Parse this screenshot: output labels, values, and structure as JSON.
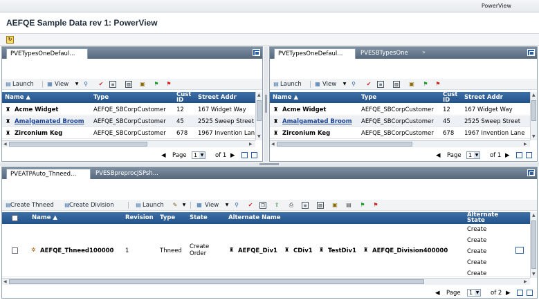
{
  "window": {
    "title": "PowerView"
  },
  "page": {
    "title": "AEFQE Sample Data rev 1: PowerView"
  },
  "toolbar": {
    "icon": "refresh-icon"
  },
  "left_pane": {
    "tabs": [
      {
        "label": "PVETypesOneDefaul..."
      }
    ],
    "toolbar": {
      "launch": "Launch",
      "view": "View"
    },
    "columns": {
      "name": "Name",
      "type": "Type",
      "cust_id_1": "Cust",
      "cust_id_2": "ID",
      "street": "Street Addr"
    },
    "rows": [
      {
        "name": "Acme Widget",
        "type": "AEFQE_SBCorpCustomer",
        "id": "12",
        "street": "167 Widget Way"
      },
      {
        "name": "Amalgamated Broom",
        "type": "AEFQE_SBCorpCustomer",
        "id": "45",
        "street": "2525 Sweep Street"
      },
      {
        "name": "Zirconium Keg",
        "type": "AEFQE_SBCorpCustomer",
        "id": "678",
        "street": "1967 Invention Lane"
      }
    ],
    "pager": {
      "page_label": "Page",
      "page_value": "1",
      "of_label": "of 1"
    }
  },
  "right_pane": {
    "tabs": [
      {
        "label": "PVETypesOneDefaul..."
      },
      {
        "label": "PVESBTypesOne"
      }
    ],
    "overflow": "»",
    "toolbar": {
      "launch": "Launch",
      "view": "View"
    },
    "columns": {
      "name": "Name",
      "type": "Type",
      "cust_id_1": "Cust",
      "cust_id_2": "ID",
      "street": "Street Addr"
    },
    "rows": [
      {
        "name": "Acme Widget",
        "type": "AEFQE_SBCorpCustomer",
        "id": "12",
        "street": "167 Widget Way"
      },
      {
        "name": "Amalgamated Broom",
        "type": "AEFQE_SBCorpCustomer",
        "id": "45",
        "street": "2525 Sweep Street"
      },
      {
        "name": "Zirconium Keg",
        "type": "AEFQE_SBCorpCustomer",
        "id": "678",
        "street": "1967 Invention Lane"
      }
    ],
    "pager": {
      "page_label": "Page",
      "page_value": "1",
      "of_label": "of 1"
    }
  },
  "bottom_pane": {
    "tabs": [
      {
        "label": "PVEATPAuto_Thneed..."
      },
      {
        "label": "PVESBpreprocJSPsh..."
      }
    ],
    "toolbar": {
      "create_thneed": "Create Thneed",
      "create_division": "Create Division",
      "launch": "Launch",
      "view": "View"
    },
    "columns": {
      "name": "Name",
      "revision": "Revision",
      "type": "Type",
      "state": "State",
      "alt_name": "Alternate Name",
      "alt_state_1": "Alternate",
      "alt_state_2": "State"
    },
    "row": {
      "name": "AEFQE_Thneed100000",
      "revision": "1",
      "type": "Thneed",
      "state_1": "Create",
      "state_2": "Order",
      "alt_names": [
        "AEFQE_Div1",
        "CDiv1",
        "TestDiv1",
        "AEFQE_Division400000"
      ],
      "alt_states": [
        "Create",
        "Create",
        "Create",
        "Create",
        "Create"
      ]
    },
    "pager": {
      "page_label": "Page",
      "page_value": "1",
      "of_label": "of 2"
    }
  }
}
